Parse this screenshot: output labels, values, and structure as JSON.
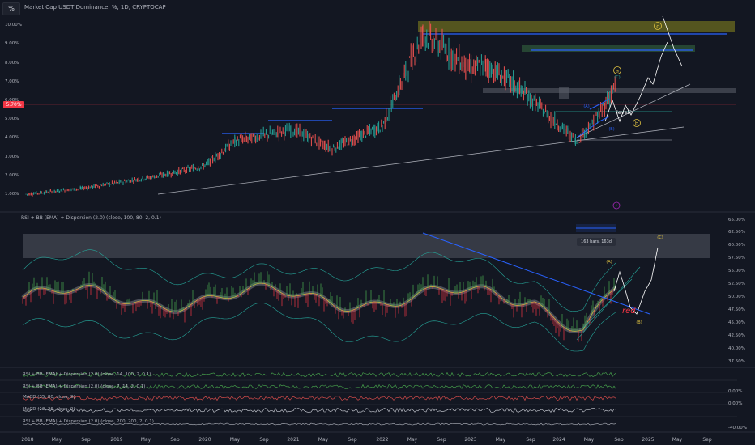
{
  "toolbar": {
    "symbol_button": "%"
  },
  "chart_title": "Market Cap USDT Dominance, %, 1D, CRYPTOCAP",
  "price_tag": "5.70%",
  "annotations": {
    "wave_a": "a",
    "wave_b": "b",
    "wave_c": "c",
    "wave_C_upper": "(C)",
    "wave_B_upper": "(B)",
    "wave_A_upper": "(A)",
    "level_note": "level?",
    "ind_wave_A": "(A)",
    "ind_wave_B": "(B)",
    "ind_wave_C": "(C)",
    "red_note": "red",
    "bars_tooltip": "163 bars, 163d"
  },
  "indicator_title": "RSI + BB (EMA) + Dispersion (2.0) (close, 100, 80, 2, 0.1)",
  "mini_panels": [
    {
      "label": "RSI + BB (EMA) + Dispersion (2.0) (close, 14, 100, 2, 0.1)"
    },
    {
      "label": "RSI + BB (EMA) + Dispersion (2.0) (close, 7, 14, 2, 0.1)"
    },
    {
      "label": "MACD (35, 80, close, 9)",
      "value": "0.00%"
    },
    {
      "label": "MACD (12, 26, close, 9)",
      "value": "0.00%"
    },
    {
      "label": "RSI + BB (EMA) + Dispersion (2.0) (close, 200, 200, 2, 0.1)",
      "value": "-40.00%"
    }
  ],
  "colors": {
    "background": "#131722",
    "up": "#26a69a",
    "down": "#ef5350",
    "resistance": "#2962ff",
    "zone": "#6b6b1f",
    "rsi_green": "#4caf50",
    "rsi_red": "#f23645",
    "rsi_yellow": "#e0c341"
  },
  "chart_data": [
    {
      "type": "line",
      "title": "Market Cap USDT Dominance, %, 1D, CRYPTOCAP",
      "x": [
        "2018",
        "2018-07",
        "2019",
        "2019-07",
        "2020",
        "2020-07",
        "2021",
        "2021-07",
        "2022",
        "2022-05",
        "2022-11",
        "2023",
        "2023-07",
        "2024",
        "2024-04",
        "2024-08"
      ],
      "values": [
        1.0,
        1.3,
        1.6,
        2.0,
        2.5,
        3.8,
        4.4,
        3.4,
        4.6,
        9.5,
        7.6,
        7.8,
        6.6,
        3.8,
        5.2,
        6.8
      ],
      "ylim": [
        0.5,
        10.3
      ],
      "y_ticks": [
        "10.00%",
        "9.00%",
        "8.00%",
        "7.00%",
        "6.00%",
        "5.00%",
        "4.00%",
        "3.00%",
        "2.00%",
        "1.00%"
      ],
      "x_ticks": [
        "2018",
        "May",
        "Sep",
        "2019",
        "May",
        "Sep",
        "2020",
        "May",
        "Sep",
        "2021",
        "May",
        "Sep",
        "2022",
        "May",
        "Sep",
        "2023",
        "May",
        "Sep",
        "2024",
        "May",
        "Sep",
        "2025",
        "May",
        "Sep"
      ]
    },
    {
      "type": "line",
      "title": "RSI + BB (EMA) + Dispersion (2.0) (close, 100, 80, 2, 0.1)",
      "ylim": [
        37.5,
        65
      ],
      "y_ticks": [
        "65.00%",
        "62.50%",
        "60.00%",
        "57.50%",
        "55.00%",
        "52.50%",
        "50.00%",
        "47.50%",
        "45.00%",
        "42.50%",
        "40.00%",
        "37.50%"
      ]
    }
  ]
}
